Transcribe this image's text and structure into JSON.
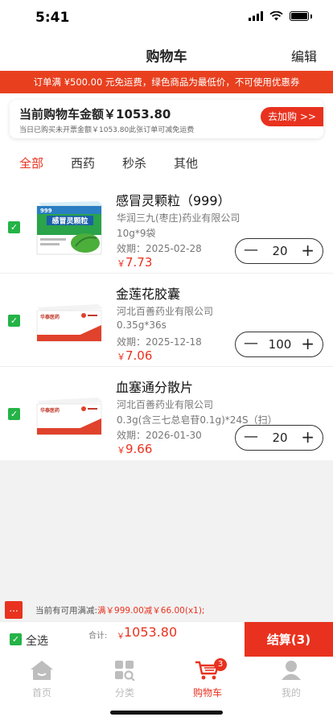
{
  "status": {
    "time": "5:41"
  },
  "nav": {
    "title": "购物车",
    "edit": "编辑"
  },
  "promo": {
    "text": "订单满 ¥500.00 元免运费，绿色商品为最低价，不可使用优惠券"
  },
  "summary": {
    "title": "当前购物车金额￥1053.80",
    "subtitle": "当日已购买未开票金额￥1053.80此张订单可减免运费",
    "add_more": "去加购 >>"
  },
  "tabs": [
    {
      "label": "全部",
      "active": true
    },
    {
      "label": "西药",
      "active": false
    },
    {
      "label": "秒杀",
      "active": false
    },
    {
      "label": "其他",
      "active": false
    }
  ],
  "products": [
    {
      "name": "感冒灵颗粒（999）",
      "maker": "华润三九(枣庄)药业有限公司",
      "spec": "10g*9袋",
      "expiry": "效期：2025-02-28",
      "price_symbol": "￥",
      "price": "7.73",
      "qty": "20",
      "checked": true,
      "package": "green-box"
    },
    {
      "name": "金莲花胶囊",
      "maker": "河北百善药业有限公司",
      "spec": "0.35g*36s",
      "expiry": "效期：2025-12-18",
      "price_symbol": "￥",
      "price": "7.06",
      "qty": "100",
      "checked": true,
      "package": "white-red-box"
    },
    {
      "name": "血塞通分散片",
      "maker": "河北百善药业有限公司",
      "spec": "0.3g(含三七总皂苷0.1g)*24S（扫）",
      "expiry": "效期：2026-01-30",
      "price_symbol": "￥",
      "price": "9.66",
      "qty": "20",
      "checked": true,
      "package": "white-red-box"
    }
  ],
  "packaging_text": {
    "box1_brand": "999",
    "box1_name": "感冒灵颗粒",
    "box2_brand": "华泰医药"
  },
  "discount": {
    "dots": "...",
    "prefix": "当前有可用满减:",
    "highlight": "满￥999.00减￥66.00(x1);"
  },
  "checkout": {
    "select_all": "全选",
    "total_label": "合计:",
    "total_symbol": "￥",
    "total": "1053.80",
    "button": "结算(3)"
  },
  "tabbar": [
    {
      "label": "首页",
      "icon": "home-icon"
    },
    {
      "label": "分类",
      "icon": "category-icon"
    },
    {
      "label": "购物车",
      "icon": "cart-icon",
      "badge": "3",
      "active": true
    },
    {
      "label": "我的",
      "icon": "user-icon"
    }
  ],
  "colors": {
    "accent": "#e8321f",
    "check": "#24b347",
    "promo_bg": "#e8401f"
  }
}
